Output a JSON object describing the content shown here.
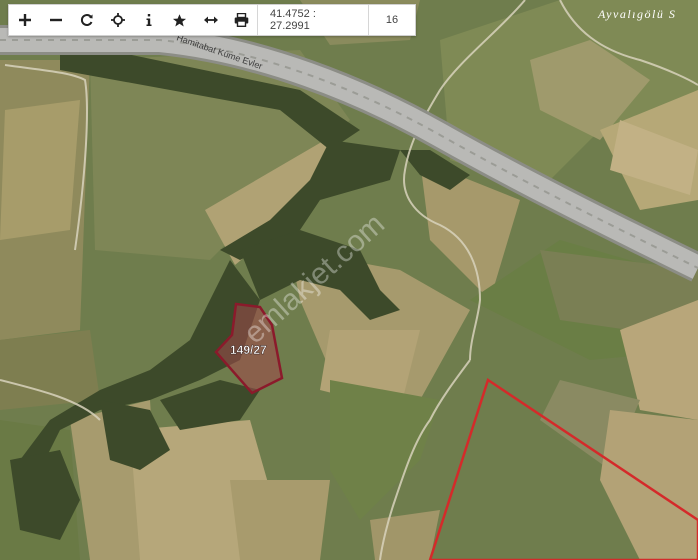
{
  "toolbar": {
    "coordinates": "41.4752 : 27.2991",
    "zoom": "16",
    "tools": [
      {
        "name": "zoom-in-icon"
      },
      {
        "name": "zoom-out-icon"
      },
      {
        "name": "refresh-icon"
      },
      {
        "name": "locate-icon"
      },
      {
        "name": "info-icon"
      },
      {
        "name": "favorite-star-icon"
      },
      {
        "name": "measure-distance-icon"
      },
      {
        "name": "print-icon"
      }
    ]
  },
  "map": {
    "place_label": "Ayvalıgölü S",
    "road_label": "Hamitabat Küme Evler",
    "parcel_label": "149/27",
    "watermark": "emlakjet.com",
    "colors": {
      "parcel_border": "#8b1a2b",
      "region_border": "#d42a2a",
      "highway": "#b9b9b6"
    }
  }
}
